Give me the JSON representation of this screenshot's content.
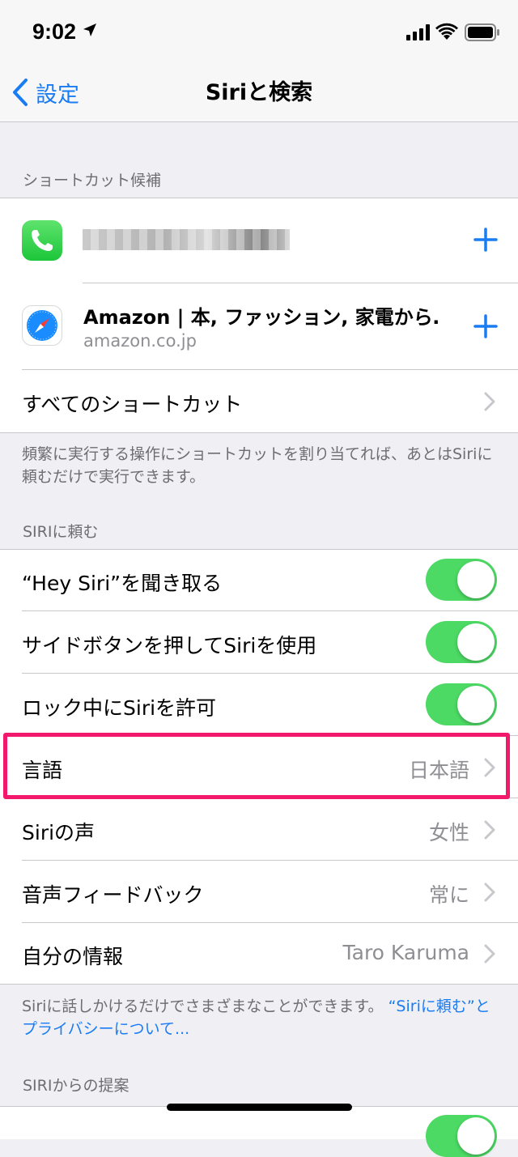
{
  "status": {
    "time": "9:02"
  },
  "nav": {
    "back_label": "設定",
    "title": "Siriと検索"
  },
  "shortcuts": {
    "header": "ショートカット候補",
    "suggestion_title": "Amazon | 本, ファッション, 家電から…",
    "suggestion_subtitle": "amazon.co.jp",
    "all_label": "すべてのショートカット",
    "footer": "頻繁に実行する操作にショートカットを割り当てれば、あとはSiriに頼むだけで実行できます。"
  },
  "ask_siri": {
    "header": "SIRIに頼む",
    "hey_siri": {
      "label": "“Hey Siri”を聞き取る",
      "on": true
    },
    "side_button": {
      "label": "サイドボタンを押してSiriを使用",
      "on": true
    },
    "locked": {
      "label": "ロック中にSiriを許可",
      "on": true
    },
    "language": {
      "label": "言語",
      "value": "日本語"
    },
    "voice": {
      "label": "Siriの声",
      "value": "女性"
    },
    "feedback": {
      "label": "音声フィードバック",
      "value": "常に"
    },
    "my_info": {
      "label": "自分の情報",
      "value": "Taro Karuma"
    },
    "footer_text": "Siriに話しかけるだけでさまざまなことができます。",
    "footer_link": "“Siriに頼む”とプライバシーについて..."
  },
  "suggestions": {
    "header": "SIRIからの提案"
  },
  "colors": {
    "accent": "#1a7cf3",
    "toggle_on": "#4cd964",
    "highlight": "#f2186b"
  }
}
